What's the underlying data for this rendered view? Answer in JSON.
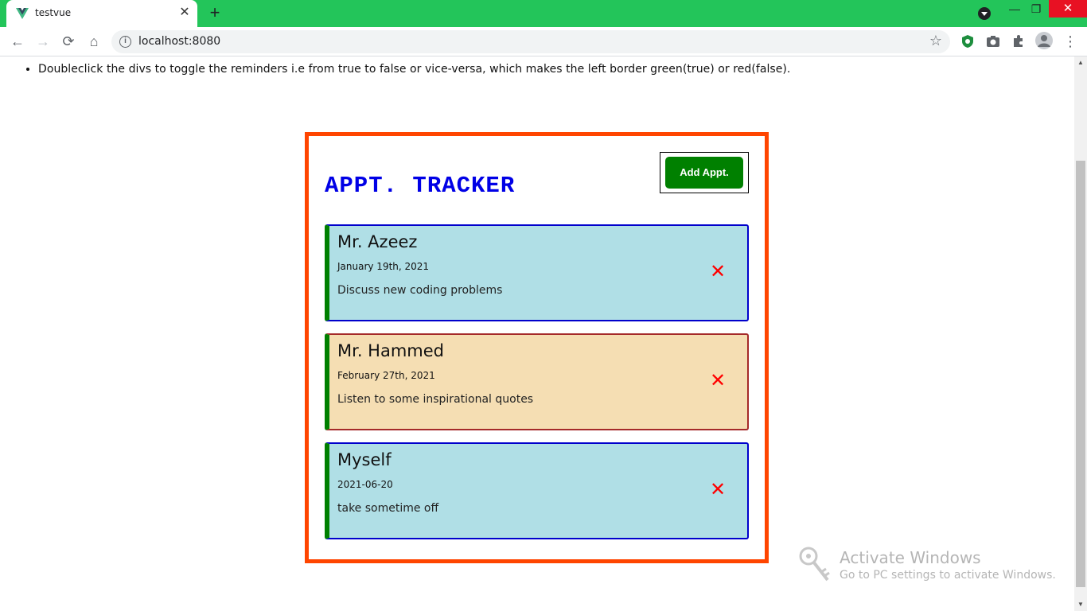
{
  "browser": {
    "tab_title": "testvue",
    "tab_close": "✕",
    "new_tab": "+",
    "url": "localhost:8080",
    "back": "←",
    "forward": "→",
    "reload": "⟳",
    "home": "⌂",
    "star": "☆",
    "menu": "⋮",
    "minimize": "—",
    "maximize": "❐",
    "close": "✕",
    "theme_color": "#23c55a"
  },
  "page": {
    "hints": [
      "Doubleclick the divs to toggle the reminders i.e from true to false or vice-versa, which makes the left border green(true) or red(false)."
    ]
  },
  "tracker": {
    "title": "APPT. TRACKER",
    "add_button": "Add Appt.",
    "border_color": "#ff4500",
    "appointments": [
      {
        "name": "Mr. Azeez",
        "date": "January 19th, 2021",
        "description": "Discuss new coding problems",
        "reminder": true,
        "delete": "✕"
      },
      {
        "name": "Mr. Hammed",
        "date": "February 27th, 2021",
        "description": "Listen to some inspirational quotes",
        "reminder": true,
        "delete": "✕"
      },
      {
        "name": "Myself",
        "date": "2021-06-20",
        "description": "take sometime off",
        "reminder": true,
        "delete": "✕"
      }
    ]
  },
  "watermark": {
    "title": "Activate Windows",
    "subtitle": "Go to PC settings to activate Windows."
  }
}
